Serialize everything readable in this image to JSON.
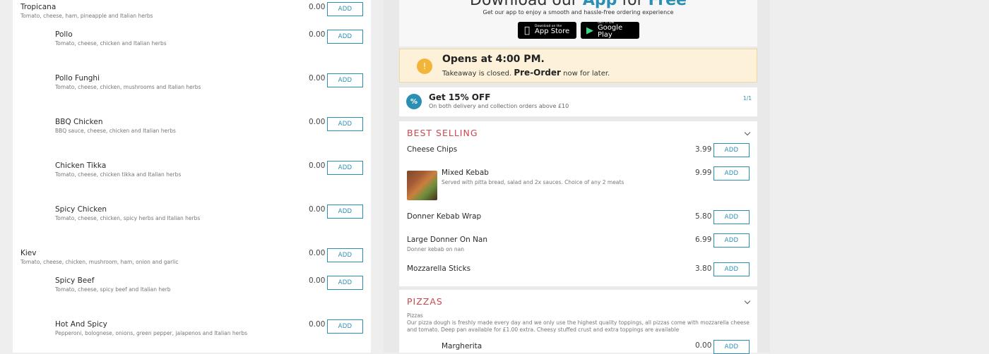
{
  "left_menu": {
    "items": [
      {
        "name": "Tropicana",
        "desc": "Tomato, cheese, ham, pineapple and Italian herbs",
        "price": "0.00",
        "add": "ADD"
      },
      {
        "name": "Pollo",
        "desc": "Tomato, cheese, chicken and Italian herbs",
        "price": "0.00",
        "add": "ADD"
      },
      {
        "name": "Pollo Funghi",
        "desc": "Tomato, cheese, chicken, mushrooms and Italian herbs",
        "price": "0.00",
        "add": "ADD"
      },
      {
        "name": "BBQ Chicken",
        "desc": "BBQ sauce, cheese, chicken and Italian herbs",
        "price": "0.00",
        "add": "ADD"
      },
      {
        "name": "Chicken Tikka",
        "desc": "Tomato, cheese, chicken tikka and Italian herbs",
        "price": "0.00",
        "add": "ADD"
      },
      {
        "name": "Spicy Chicken",
        "desc": "Tomato, cheese, chicken, spicy herbs and Italian herbs",
        "price": "0.00",
        "add": "ADD"
      },
      {
        "name": "Kiev",
        "desc": "Tomato, cheese, chicken, mushroom, ham, onion and garlic",
        "price": "0.00",
        "add": "ADD"
      },
      {
        "name": "Spicy Beef",
        "desc": "Tomato, cheese, spicy beef and Italian herb",
        "price": "0.00",
        "add": "ADD"
      },
      {
        "name": "Hot And Spicy",
        "desc": "Pepperoni, bolognese, onions, green pepper, jalapenos and Italian herbs",
        "price": "0.00",
        "add": "ADD"
      }
    ]
  },
  "app_promo": {
    "title_prefix": "Download our ",
    "title_app": "App",
    "title_mid": " for ",
    "title_free": "Free",
    "subtitle": "Get our app to enjoy a smooth and hassle-free ordering experience",
    "app_store_small": "Download on the",
    "app_store_big": "App Store",
    "google_small": "GET IT ON",
    "google_big": "Google Play"
  },
  "closed_notice": {
    "icon": "!",
    "opens": "Opens at 4:00 PM.",
    "closed_text": "Takeaway is closed.",
    "pre_order": "Pre-Order",
    "later": "now for later."
  },
  "offer": {
    "icon": "%",
    "title": "Get 15% OFF",
    "desc": "On both delivery and collection orders above £10",
    "pager": "1/1"
  },
  "best_selling": {
    "title": "BEST SELLING",
    "items": [
      {
        "name": "Cheese Chips",
        "price": "3.99",
        "add": "ADD"
      },
      {
        "name": "Mixed Kebab",
        "desc": "Served with pitta bread, salad and 2x sauces. Choice of any 2 meats",
        "price": "9.99",
        "add": "ADD"
      },
      {
        "name": "Donner Kebab Wrap",
        "price": "5.80",
        "add": "ADD"
      },
      {
        "name": "Large Donner On Nan",
        "desc": "Donner kebab on nan",
        "price": "6.99",
        "add": "ADD"
      },
      {
        "name": "Mozzarella Sticks",
        "price": "3.80",
        "add": "ADD"
      }
    ]
  },
  "pizzas": {
    "title": "PIZZAS",
    "desc_heading": "Pizzas",
    "desc": "Our pizza dough is freshly made every day and we only use the highest quality toppings, all pizzas come with mozzarella cheese and tomato. Deep pan available for £1.00 extra. Cheesy stuffed crust and extra toppings are available",
    "first_item": {
      "name": "Margherita",
      "price": "0.00",
      "add": "ADD"
    }
  }
}
